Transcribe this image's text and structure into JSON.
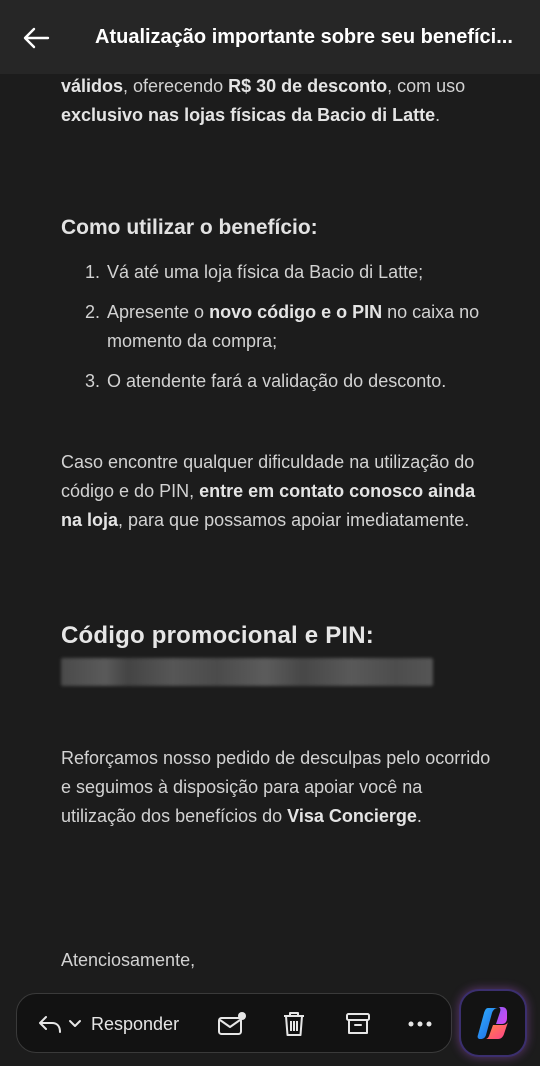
{
  "header": {
    "title": "Atualização importante sobre seu benefíci..."
  },
  "body": {
    "intro": {
      "b1": "válidos",
      "t1": ", oferecendo ",
      "b2": "R$ 30 de desconto",
      "t2": ", com uso ",
      "b3": "exclusivo nas lojas físicas da Bacio di Latte",
      "t3": "."
    },
    "how_to_title": "Como utilizar o benefício:",
    "steps": [
      {
        "num": "1.",
        "text": "Vá até uma loja física da Bacio di Latte;"
      },
      {
        "num": "2.",
        "pre": "Apresente o ",
        "bold": "novo código e o PIN",
        "post": " no caixa no momento da compra;"
      },
      {
        "num": "3.",
        "text": "O atendente fará a validação do desconto."
      }
    ],
    "difficulty": {
      "t1": "Caso encontre qualquer dificuldade na utilização do código e do PIN, ",
      "b1": "entre em contato conosco ainda na loja",
      "t2": ", para que possamos apoiar imediatamente."
    },
    "code_title": "Código promocional e PIN:",
    "apology": {
      "t1": "Reforçamos nosso pedido de desculpas pelo ocorrido e seguimos à disposição para apoiar você na utilização dos benefícios do ",
      "b1": "Visa Concierge",
      "t2": "."
    },
    "closing": "Atenciosamente,"
  },
  "toolbar": {
    "reply_label": "Responder",
    "icons": [
      "reply-icon",
      "chevron-down-icon",
      "mark-unread-icon",
      "trash-icon",
      "archive-icon",
      "more-icon"
    ]
  },
  "copilot": {
    "icon": "copilot-icon"
  }
}
